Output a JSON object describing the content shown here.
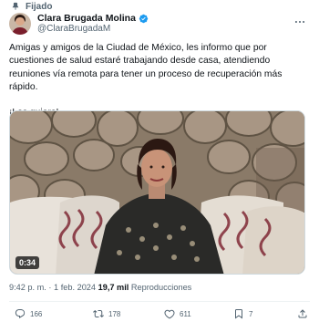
{
  "pinned": {
    "label": "Fijado",
    "icon": "pin-icon"
  },
  "author": {
    "display_name": "Clara Brugada Molina",
    "handle": "@ClaraBrugadaM",
    "verified": true,
    "verified_color": "#1d9bf0"
  },
  "tweet": {
    "paragraph_1": "Amigas y amigos de la Ciudad de México, les informo que por cuestiones de salud estaré trabajando desde casa, atendiendo reuniones vía remota para tener un proceso de recuperación más rápido.",
    "paragraph_2": "¡Los quiero!"
  },
  "media": {
    "duration": "0:34"
  },
  "meta": {
    "time": "9:42 p. m.",
    "separator": "·",
    "date": "1 feb. 2024",
    "views_count": "19,7 mil",
    "views_label": "Reproducciones"
  },
  "actions": {
    "replies": "166",
    "retweets": "178",
    "likes": "611",
    "bookmarks": "7"
  },
  "colors": {
    "text": "#0f1419",
    "secondary": "#536471",
    "accent": "#1d9bf0"
  }
}
